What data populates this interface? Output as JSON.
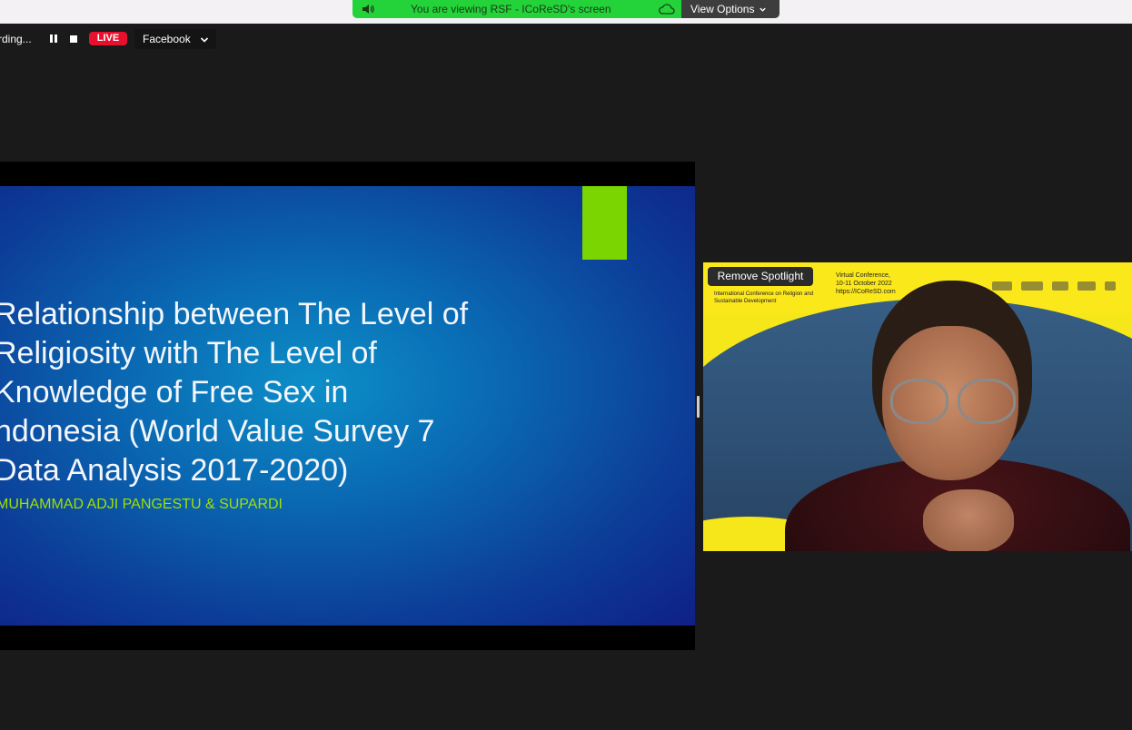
{
  "banner": {
    "message": "You are viewing RSF - ICoReSD's screen",
    "view_options_label": "View Options",
    "speaker_icon": "speaker-icon",
    "cloud_icon": "cloud-icon"
  },
  "recording": {
    "label": "rding...",
    "live_label": "LIVE",
    "stream_target": "Facebook"
  },
  "slide": {
    "title_lines": [
      "Relationship between The Level of",
      "Religiosity with The Level of",
      "Knowledge of Free Sex in",
      "ndonesia (World Value Survey 7",
      "Data Analysis 2017-2020)"
    ],
    "authors": "MUHAMMAD ADJI PANGESTU & SUPARDI",
    "accent_color": "#7ad500",
    "author_color": "#9ee100"
  },
  "video": {
    "spotlight_label": "Remove Spotlight",
    "conference_name": "International Conference on Religion and Sustainable Development",
    "conference_type": "Virtual Conference,",
    "conference_dates": "10-11 October 2022",
    "conference_url": "https://ICoReSD.com"
  },
  "colors": {
    "banner_green": "#24d33a",
    "live_red": "#e8112d",
    "background": "#1a1a1a"
  }
}
